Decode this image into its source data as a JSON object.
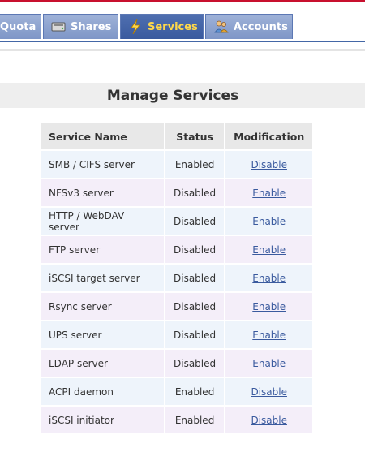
{
  "nav": {
    "tabs": [
      {
        "label": "Quota",
        "icon": "quota-icon"
      },
      {
        "label": "Shares",
        "icon": "drive-icon"
      },
      {
        "label": "Services",
        "icon": "lightning-icon"
      },
      {
        "label": "Accounts",
        "icon": "users-icon"
      }
    ],
    "active": "Services"
  },
  "page": {
    "title": "Manage Services"
  },
  "table": {
    "headers": [
      "Service Name",
      "Status",
      "Modification"
    ],
    "rows": [
      {
        "name": "SMB / CIFS server",
        "status": "Enabled",
        "action": "Disable"
      },
      {
        "name": "NFSv3 server",
        "status": "Disabled",
        "action": "Enable"
      },
      {
        "name": "HTTP / WebDAV server",
        "status": "Disabled",
        "action": "Enable"
      },
      {
        "name": "FTP server",
        "status": "Disabled",
        "action": "Enable"
      },
      {
        "name": "iSCSI target server",
        "status": "Disabled",
        "action": "Enable"
      },
      {
        "name": "Rsync server",
        "status": "Disabled",
        "action": "Enable"
      },
      {
        "name": "UPS server",
        "status": "Disabled",
        "action": "Enable"
      },
      {
        "name": "LDAP server",
        "status": "Disabled",
        "action": "Enable"
      },
      {
        "name": "ACPI daemon",
        "status": "Enabled",
        "action": "Disable"
      },
      {
        "name": "iSCSI initiator",
        "status": "Enabled",
        "action": "Disable"
      }
    ]
  },
  "colors": {
    "accent": "#3a5a9e",
    "active_tab_text": "#ffd84a",
    "top_line": "#c8102e"
  }
}
